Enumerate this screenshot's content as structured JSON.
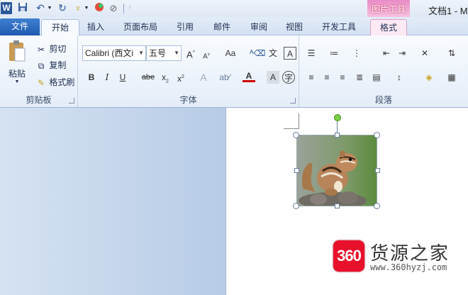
{
  "window": {
    "title": "文档1 - M",
    "word_icon": "W"
  },
  "quick_access": [
    "save-icon",
    "undo-icon",
    "redo-icon",
    "format-painter-icon",
    "color-icon",
    "draw-icon",
    "customize-icon"
  ],
  "context_tab_group": "图片工具",
  "tabs": [
    "文件",
    "开始",
    "插入",
    "页面布局",
    "引用",
    "邮件",
    "审阅",
    "视图",
    "开发工具",
    "格式"
  ],
  "clipboard": {
    "paste": "粘贴",
    "cut": "剪切",
    "copy": "复制",
    "format_painter": "格式刷",
    "group": "剪贴板"
  },
  "font": {
    "name": "Calibri (西文i",
    "size": "五号",
    "group": "字体",
    "text_color": "#cc0000"
  },
  "paragraph": {
    "group": "段落"
  },
  "watermark": {
    "logo": "360",
    "text": "货源之家",
    "url": "www.360hyzj.com"
  },
  "colors": {
    "file_tab": "#1f5bb0",
    "context": "#e98bc6",
    "logo": "#e8102b"
  }
}
